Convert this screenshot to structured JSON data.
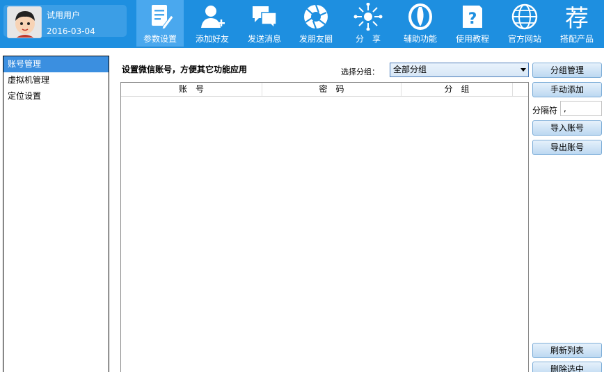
{
  "user": {
    "name": "试用用户",
    "date": "2016-03-04"
  },
  "nav": [
    {
      "label": "参数设置",
      "icon": "document-edit-icon",
      "active": true
    },
    {
      "label": "添加好友",
      "icon": "add-user-icon"
    },
    {
      "label": "发送消息",
      "icon": "chat-bubbles-icon"
    },
    {
      "label": "发朋友圈",
      "icon": "camera-aperture-icon"
    },
    {
      "label": "分　享",
      "icon": "share-burst-icon"
    },
    {
      "label": "辅助功能",
      "icon": "leaf-icon"
    },
    {
      "label": "使用教程",
      "icon": "help-folder-icon"
    },
    {
      "label": "官方网站",
      "icon": "globe-icon"
    },
    {
      "label": "搭配产品",
      "icon": "recommend-char-icon",
      "glyph": "荐"
    }
  ],
  "sidebar": {
    "items": [
      {
        "label": "账号管理",
        "selected": true
      },
      {
        "label": "虚拟机管理"
      },
      {
        "label": "定位设置"
      }
    ]
  },
  "main": {
    "title": "设置微信账号，方便其它功能应用",
    "group_label": "选择分组：",
    "group_selected": "全部分组",
    "table": {
      "columns": [
        "账　号",
        "密　码",
        "分　组"
      ],
      "rows": []
    }
  },
  "actions": {
    "group_manage": "分组管理",
    "manual_add": "手动添加",
    "separator_label": "分隔符",
    "separator_value": ",",
    "import": "导入账号",
    "export": "导出账号",
    "refresh": "刷新列表",
    "delete_selected": "删除选中"
  },
  "colors": {
    "header": "#1e8fe0",
    "selected": "#3b8fe0"
  }
}
